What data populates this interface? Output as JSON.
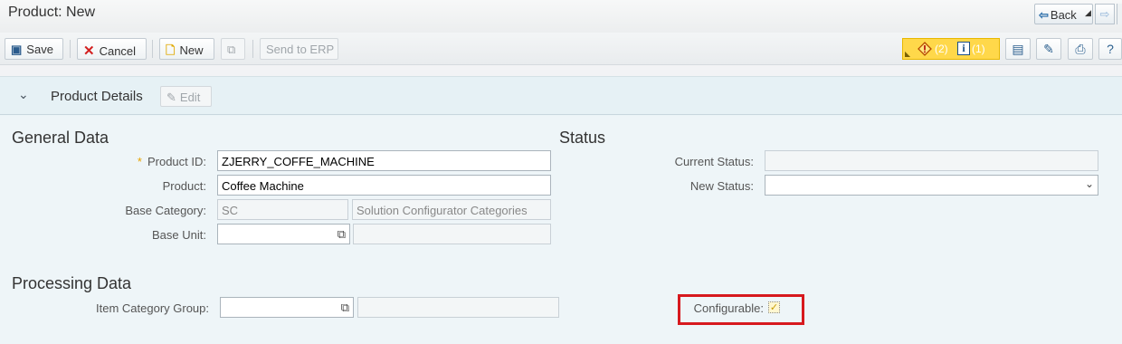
{
  "window": {
    "title": "Product: New"
  },
  "nav": {
    "back_label": "Back"
  },
  "toolbar": {
    "save_label": "Save",
    "cancel_label": "Cancel",
    "new_label": "New",
    "send_label": "Send to ERP",
    "warning_count": "(2)",
    "info_count": "(1)"
  },
  "section": {
    "title": "Product Details",
    "edit_label": "Edit"
  },
  "general": {
    "heading": "General Data",
    "product_id_label": "Product ID:",
    "product_id_value": "ZJERRY_COFFE_MACHINE",
    "product_label": "Product:",
    "product_value": "Coffee Machine",
    "base_category_label": "Base Category:",
    "base_category_value": "SC",
    "base_category_desc": "Solution Configurator Categories",
    "base_unit_label": "Base Unit:",
    "base_unit_value": "",
    "base_unit_desc": ""
  },
  "status": {
    "heading": "Status",
    "current_label": "Current Status:",
    "current_value": "",
    "new_label": "New Status:",
    "new_value": ""
  },
  "processing": {
    "heading": "Processing Data",
    "icg_label": "Item Category Group:",
    "icg_value": "",
    "icg_desc": "",
    "configurable_label": "Configurable:",
    "configurable_checked": true
  },
  "colors": {
    "highlight": "#d7191e",
    "message_bar": "#ffd84a",
    "accent": "#2b6eaa"
  }
}
